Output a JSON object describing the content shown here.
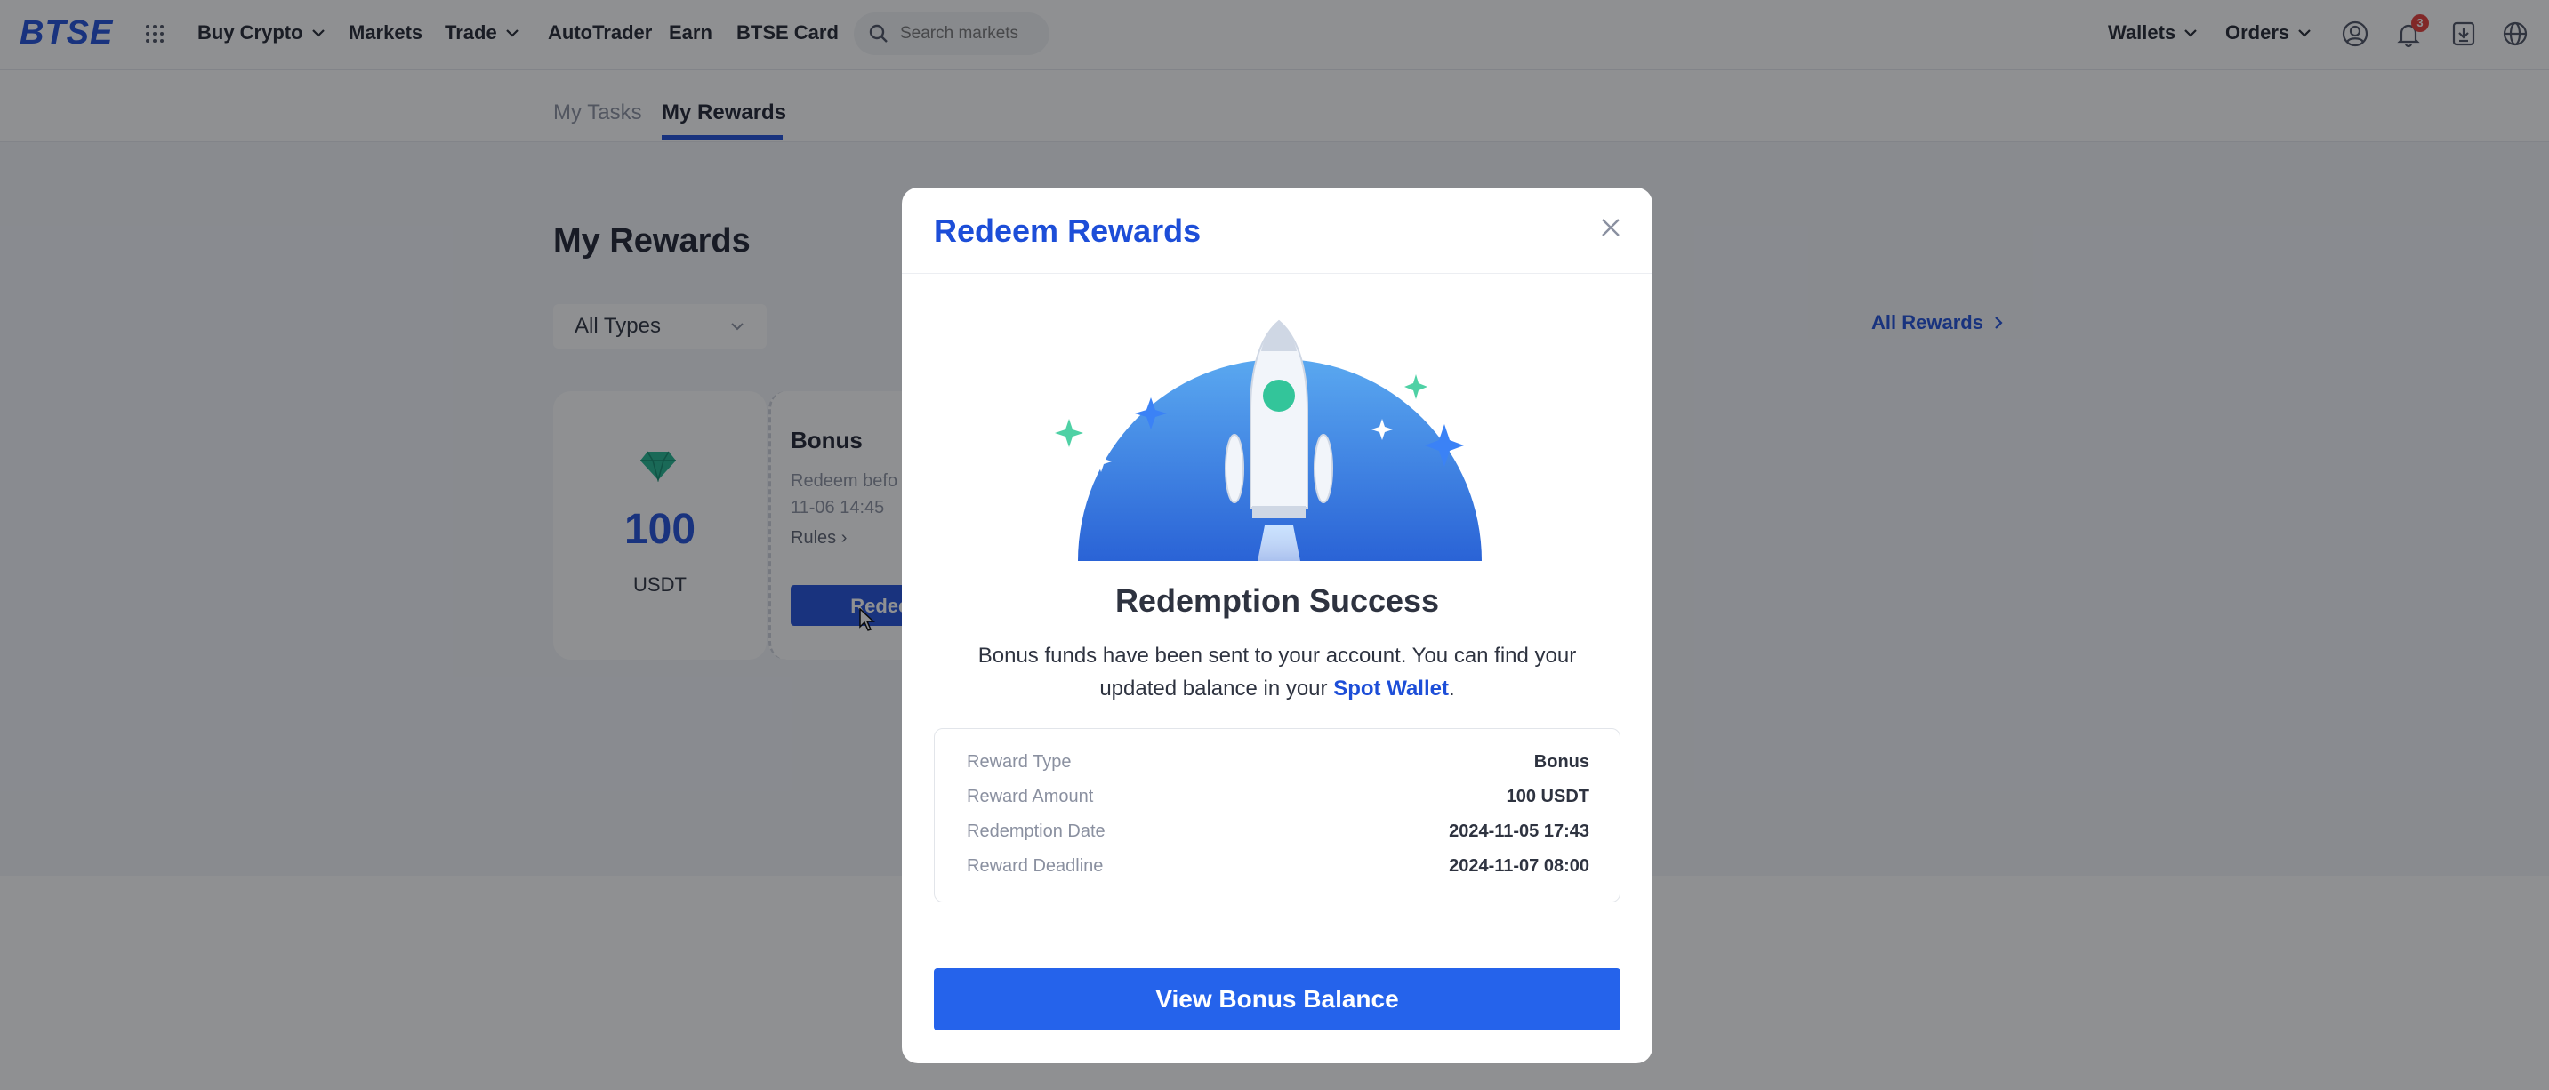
{
  "nav": {
    "logo": "BTSE",
    "items": [
      "Buy Crypto",
      "Markets",
      "Trade",
      "AutoTrader",
      "Earn",
      "BTSE Card"
    ],
    "search_placeholder": "Search markets",
    "wallets": "Wallets",
    "orders": "Orders",
    "notification_count": "3"
  },
  "subnav": {
    "tabs": [
      "My Tasks",
      "My Rewards"
    ],
    "active": "My Rewards"
  },
  "page": {
    "title": "My Rewards",
    "type_filter": "All Types",
    "all_rewards_link": "All Rewards",
    "card": {
      "amount": "100",
      "unit": "USDT",
      "title": "Bonus",
      "deadline_line1": "Redeem befo",
      "deadline_line2": "11-06 14:45",
      "rules": "Rules",
      "redeem_button": "Redeem"
    }
  },
  "modal": {
    "title": "Redeem Rewards",
    "success_title": "Redemption Success",
    "message_prefix": "Bonus funds have been sent to your account. You can find your updated balance in your",
    "message_link": "Spot Wallet",
    "message_suffix": ".",
    "details": [
      {
        "label": "Reward Type",
        "value": "Bonus"
      },
      {
        "label": "Reward Amount",
        "value": "100 USDT"
      },
      {
        "label": "Redemption Date",
        "value": "2024-11-05 17:43"
      },
      {
        "label": "Reward Deadline",
        "value": "2024-11-07 08:00"
      }
    ],
    "primary_button": "View Bonus Balance"
  },
  "colors": {
    "accent": "#1d4ed8",
    "button": "#2563eb",
    "badge": "#e53935"
  }
}
